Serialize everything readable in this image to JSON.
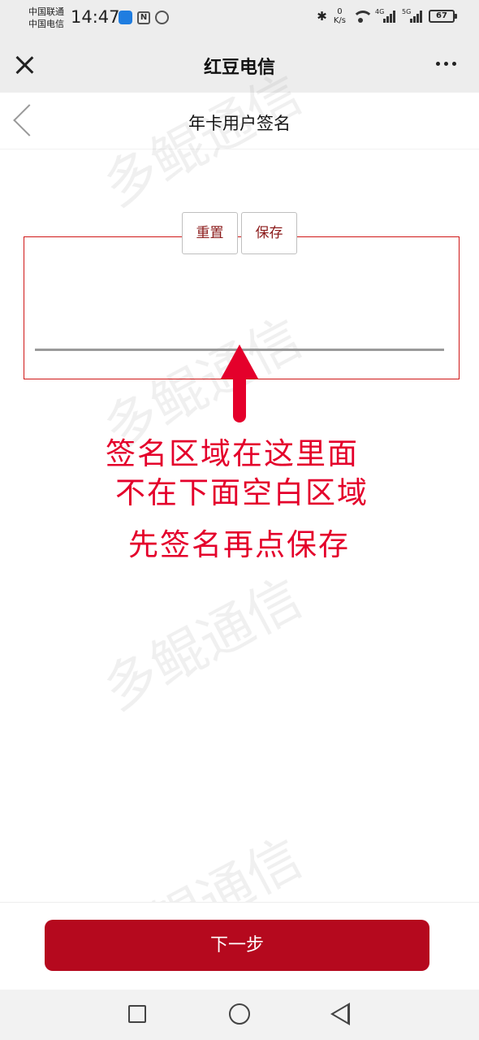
{
  "status_bar": {
    "carrier_1": "中国联通",
    "carrier_2": "中国电信",
    "time": "14:47",
    "net_speed_value": "0",
    "net_speed_unit": "K/s",
    "signal_1_label": "4G",
    "signal_2_label": "5G",
    "battery": "67"
  },
  "app_bar": {
    "title": "红豆电信"
  },
  "page": {
    "title": "年卡用户签名"
  },
  "signature": {
    "reset_label": "重置",
    "save_label": "保存"
  },
  "annotation": {
    "line_1": "签名区域在这里面",
    "line_2": "不在下面空白区域",
    "line_3": "先签名再点保存",
    "color": "#e4002b"
  },
  "watermark_text": "多鲲通信",
  "footer": {
    "next_label": "下一步",
    "button_color": "#b5091e"
  }
}
